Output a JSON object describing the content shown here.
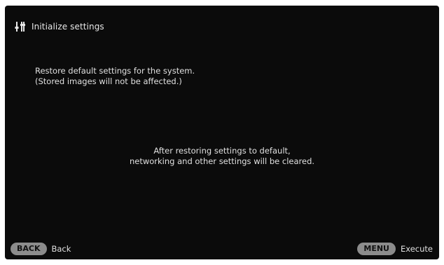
{
  "header": {
    "title": "Initialize settings",
    "icon": "settings-tools-icon"
  },
  "description": {
    "line1": "Restore default settings for the system.",
    "line2": "(Stored images will not be affected.)"
  },
  "notice": {
    "line1": "After restoring settings to default,",
    "line2": "networking and other settings will be cleared."
  },
  "footer": {
    "back_key": "BACK",
    "back_label": "Back",
    "menu_key": "MENU",
    "menu_label": "Execute"
  },
  "colors": {
    "background": "#0b0b0b",
    "text": "#e0e0e0",
    "pill": "#8c8c8c"
  }
}
